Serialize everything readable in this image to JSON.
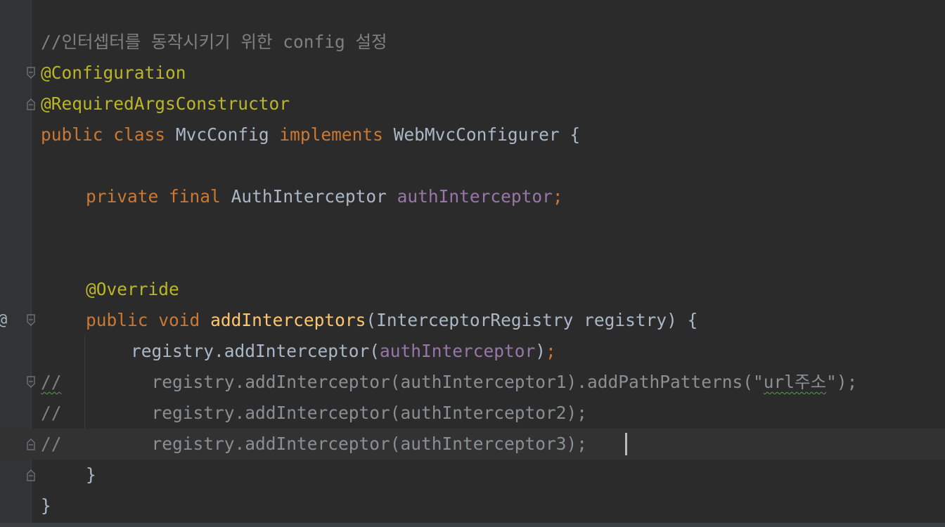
{
  "editor": {
    "lines": {
      "l1": {
        "comment": "//인터셉터를 동작시키기 위한 config 설정"
      },
      "l2": {
        "annotation": "@Configuration"
      },
      "l3": {
        "annotation": "@RequiredArgsConstructor"
      },
      "l4": {
        "kw_public": "public",
        "kw_class": "class",
        "class_name": "MvcConfig",
        "kw_implements": "implements",
        "interface_name": "WebMvcConfigurer",
        "brace": "{"
      },
      "l6": {
        "kw_private": "private",
        "kw_final": "final",
        "type": "AuthInterceptor",
        "field": "authInterceptor",
        "semicolon": ";"
      },
      "l9": {
        "annotation": "@Override"
      },
      "l10": {
        "kw_public": "public",
        "kw_void": "void",
        "method": "addInterceptors",
        "params_open": "(",
        "param_type": "InterceptorRegistry",
        "param_name": "registry",
        "params_close": ")",
        "brace": "{"
      },
      "l11": {
        "prefix": "registry.addInterceptor(",
        "field": "authInterceptor",
        "suffix": ")",
        "semicolon": ";"
      },
      "l12": {
        "marker": "//",
        "code_a": "registry.addInterceptor(authInterceptor1).addPathPatterns(\"",
        "code_typo": "url주소",
        "code_b": "\");"
      },
      "l13": {
        "marker": "//",
        "code": "registry.addInterceptor(authInterceptor2);"
      },
      "l14": {
        "marker": "//",
        "code": "registry.addInterceptor(authInterceptor3);"
      },
      "l15": {
        "brace": "}"
      },
      "l16": {
        "brace": "}"
      }
    },
    "gutter": {
      "override_symbol": "@"
    },
    "colors": {
      "background": "#2b2b2b",
      "keyword": "#cc7832",
      "annotation": "#bbb529",
      "field": "#9876aa",
      "method": "#ffc66d",
      "comment": "#808080",
      "text": "#a9b7c6"
    }
  }
}
